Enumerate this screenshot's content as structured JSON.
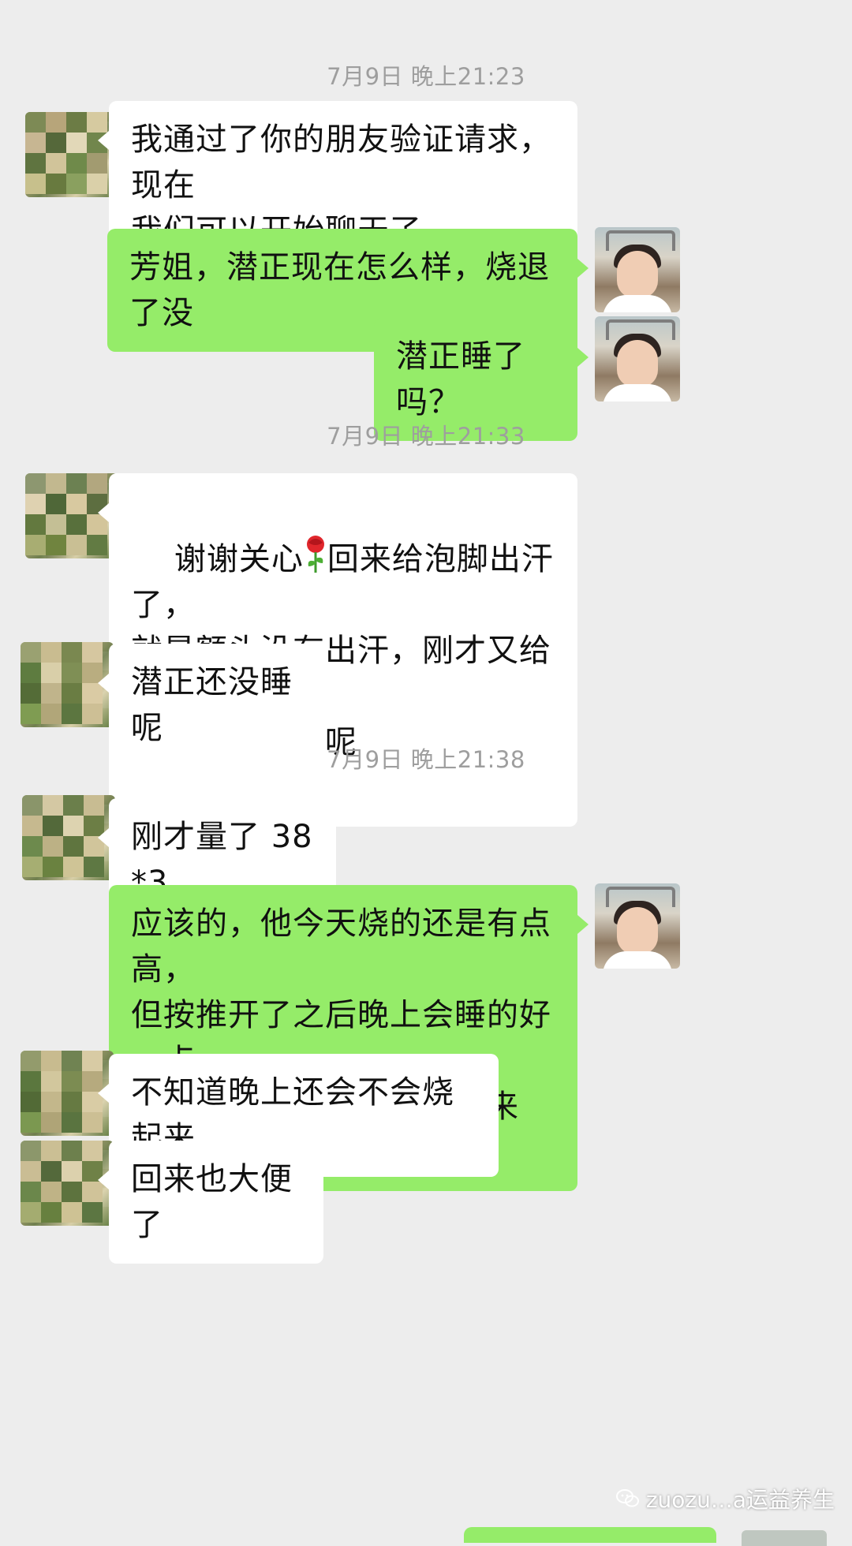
{
  "colors": {
    "background": "#ededed",
    "bubble_self": "#95ec69",
    "bubble_other": "#ffffff",
    "timestamp": "#9e9e9e"
  },
  "messages": [
    {
      "type": "time",
      "text": "7月9日 晚上21:23"
    },
    {
      "type": "other",
      "avatar_icon": "blurred-avatar",
      "text": "我通过了你的朋友验证请求，现在\n我们可以开始聊天了"
    },
    {
      "type": "self",
      "avatar_icon": "profile-photo",
      "text": "芳姐，潜正现在怎么样，烧退了没"
    },
    {
      "type": "self",
      "avatar_icon": "profile-photo",
      "text": "潜正睡了吗？"
    },
    {
      "type": "time",
      "text": "7月9日 晚上21:33"
    },
    {
      "type": "other",
      "avatar_icon": "blurred-avatar",
      "text_before_emoji": "谢谢关心",
      "emoji": "rose-emoji",
      "text_after_emoji": "回来给泡脚出汗了，\n就是额头没有出汗，刚才又给泡澡\n了，给量体温呢"
    },
    {
      "type": "other",
      "avatar_icon": "blurred-avatar",
      "text": "潜正还没睡呢"
    },
    {
      "type": "time",
      "text": "7月9日 晚上21:38"
    },
    {
      "type": "other",
      "avatar_icon": "blurred-avatar",
      "text": "刚才量了 38*3"
    },
    {
      "type": "self",
      "avatar_icon": "profile-photo",
      "text": "应该的，他今天烧的还是有点高，\n但按推开了之后晚上会睡的好一点\n的，大部分的寒湿都排出来了。"
    },
    {
      "type": "other",
      "avatar_icon": "blurred-avatar",
      "text": "不知道晚上还会不会烧起来"
    },
    {
      "type": "other",
      "avatar_icon": "blurred-avatar",
      "text": "回来也大便了"
    }
  ],
  "watermark": {
    "icon": "wechat-icon",
    "text": "zuozu…a运益养生"
  }
}
